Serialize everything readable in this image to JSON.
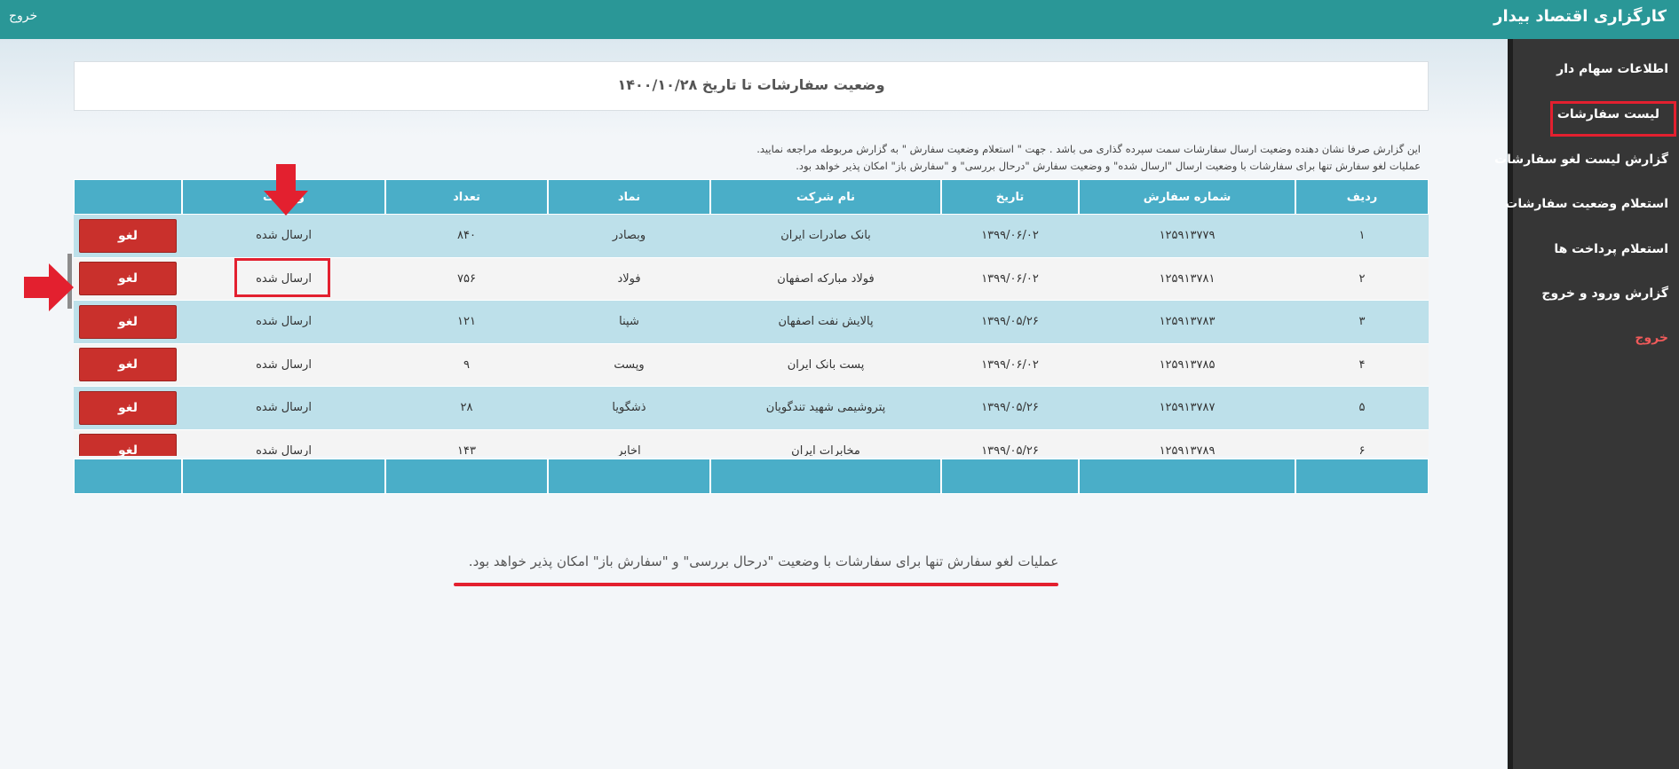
{
  "topbar": {
    "brand": "کارگزاری اقتصاد بیدار",
    "exit_label": "خروج"
  },
  "sidebar": {
    "items": [
      {
        "label": "اطلاعات سهام دار"
      },
      {
        "label": "لیست سفارشات"
      },
      {
        "label": "گزارش لیست لغو سفارشات"
      },
      {
        "label": "استعلام وضعیت سفارشات"
      },
      {
        "label": "استعلام پرداخت ها"
      },
      {
        "label": "گزارش ورود و خروج"
      },
      {
        "label": "خروج"
      }
    ],
    "active_index": 1
  },
  "main": {
    "title": "وضعیت سفارشات تا تاریخ ۱۴۰۰/۱۰/۲۸",
    "note_line1": "این گزارش صرفا نشان دهنده وضعیت ارسال سفارشات سمت سپرده گذاری می باشد . جهت \" استعلام وضعیت سفارش \" به گزارش مربوطه مراجعه نمایید.",
    "note_line2": "عملیات لغو سفارش تنها برای سفارشات با وضعیت ارسال \"ارسال شده\" و وضعیت سفارش \"درحال بررسی\" و \"سفارش باز\" امکان پذیر خواهد بود.",
    "bottom_note": "عملیات لغو سفارش تنها برای سفارشات با وضعیت \"درحال بررسی\" و \"سفارش باز\" امکان پذیر خواهد بود."
  },
  "table": {
    "headers": {
      "row": "ردیف",
      "order_no": "شماره سفارش",
      "date": "تاریخ",
      "company": "نام شرکت",
      "symbol": "نماد",
      "count": "تعداد",
      "status": "وضعیت",
      "action": ""
    },
    "rows": [
      {
        "row": "۱",
        "order_no": "۱۲۵۹۱۳۷۷۹",
        "date": "۱۳۹۹/۰۶/۰۲",
        "company": "بانک صادرات ایران",
        "symbol": "وبصادر",
        "count": "۸۴۰",
        "status": "ارسال شده",
        "action": "لغو"
      },
      {
        "row": "۲",
        "order_no": "۱۲۵۹۱۳۷۸۱",
        "date": "۱۳۹۹/۰۶/۰۲",
        "company": "فولاد مبارکه اصفهان",
        "symbol": "فولاد",
        "count": "۷۵۶",
        "status": "ارسال شده",
        "action": "لغو"
      },
      {
        "row": "۳",
        "order_no": "۱۲۵۹۱۳۷۸۳",
        "date": "۱۳۹۹/۰۵/۲۶",
        "company": "پالایش نفت اصفهان",
        "symbol": "شپنا",
        "count": "۱۲۱",
        "status": "ارسال شده",
        "action": "لغو"
      },
      {
        "row": "۴",
        "order_no": "۱۲۵۹۱۳۷۸۵",
        "date": "۱۳۹۹/۰۶/۰۲",
        "company": "پست بانک ایران",
        "symbol": "وپست",
        "count": "۹",
        "status": "ارسال شده",
        "action": "لغو"
      },
      {
        "row": "۵",
        "order_no": "۱۲۵۹۱۳۷۸۷",
        "date": "۱۳۹۹/۰۵/۲۶",
        "company": "پتروشیمی شهید تندگویان",
        "symbol": "ذشگویا",
        "count": "۲۸",
        "status": "ارسال شده",
        "action": "لغو"
      },
      {
        "row": "۶",
        "order_no": "۱۲۵۹۱۳۷۸۹",
        "date": "۱۳۹۹/۰۵/۲۶",
        "company": "مخابرات ایران",
        "symbol": "اخابر",
        "count": "۱۴۳",
        "status": "ارسال شده",
        "action": "لغو"
      }
    ]
  },
  "annotations": {
    "highlight_color": "#e3202f"
  }
}
